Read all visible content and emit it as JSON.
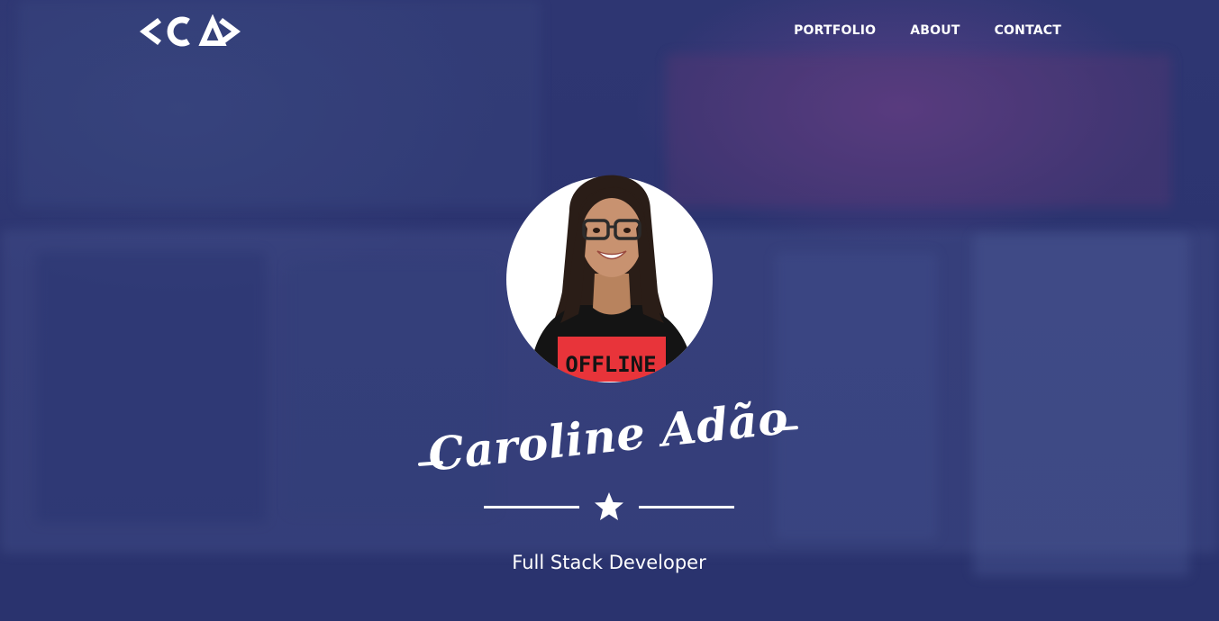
{
  "header": {
    "logo_text": "<CA>",
    "nav": [
      {
        "label": "PORTFOLIO"
      },
      {
        "label": "ABOUT"
      },
      {
        "label": "CONTACT"
      }
    ]
  },
  "hero": {
    "name": "Caroline Adão",
    "tagline": "Full Stack Developer",
    "photo_shirt_text": "OFFLINE",
    "divider_icon": "star-icon"
  },
  "colors": {
    "background": "#2b3470",
    "text": "#ffffff",
    "shirt_accent": "#e8343a"
  }
}
